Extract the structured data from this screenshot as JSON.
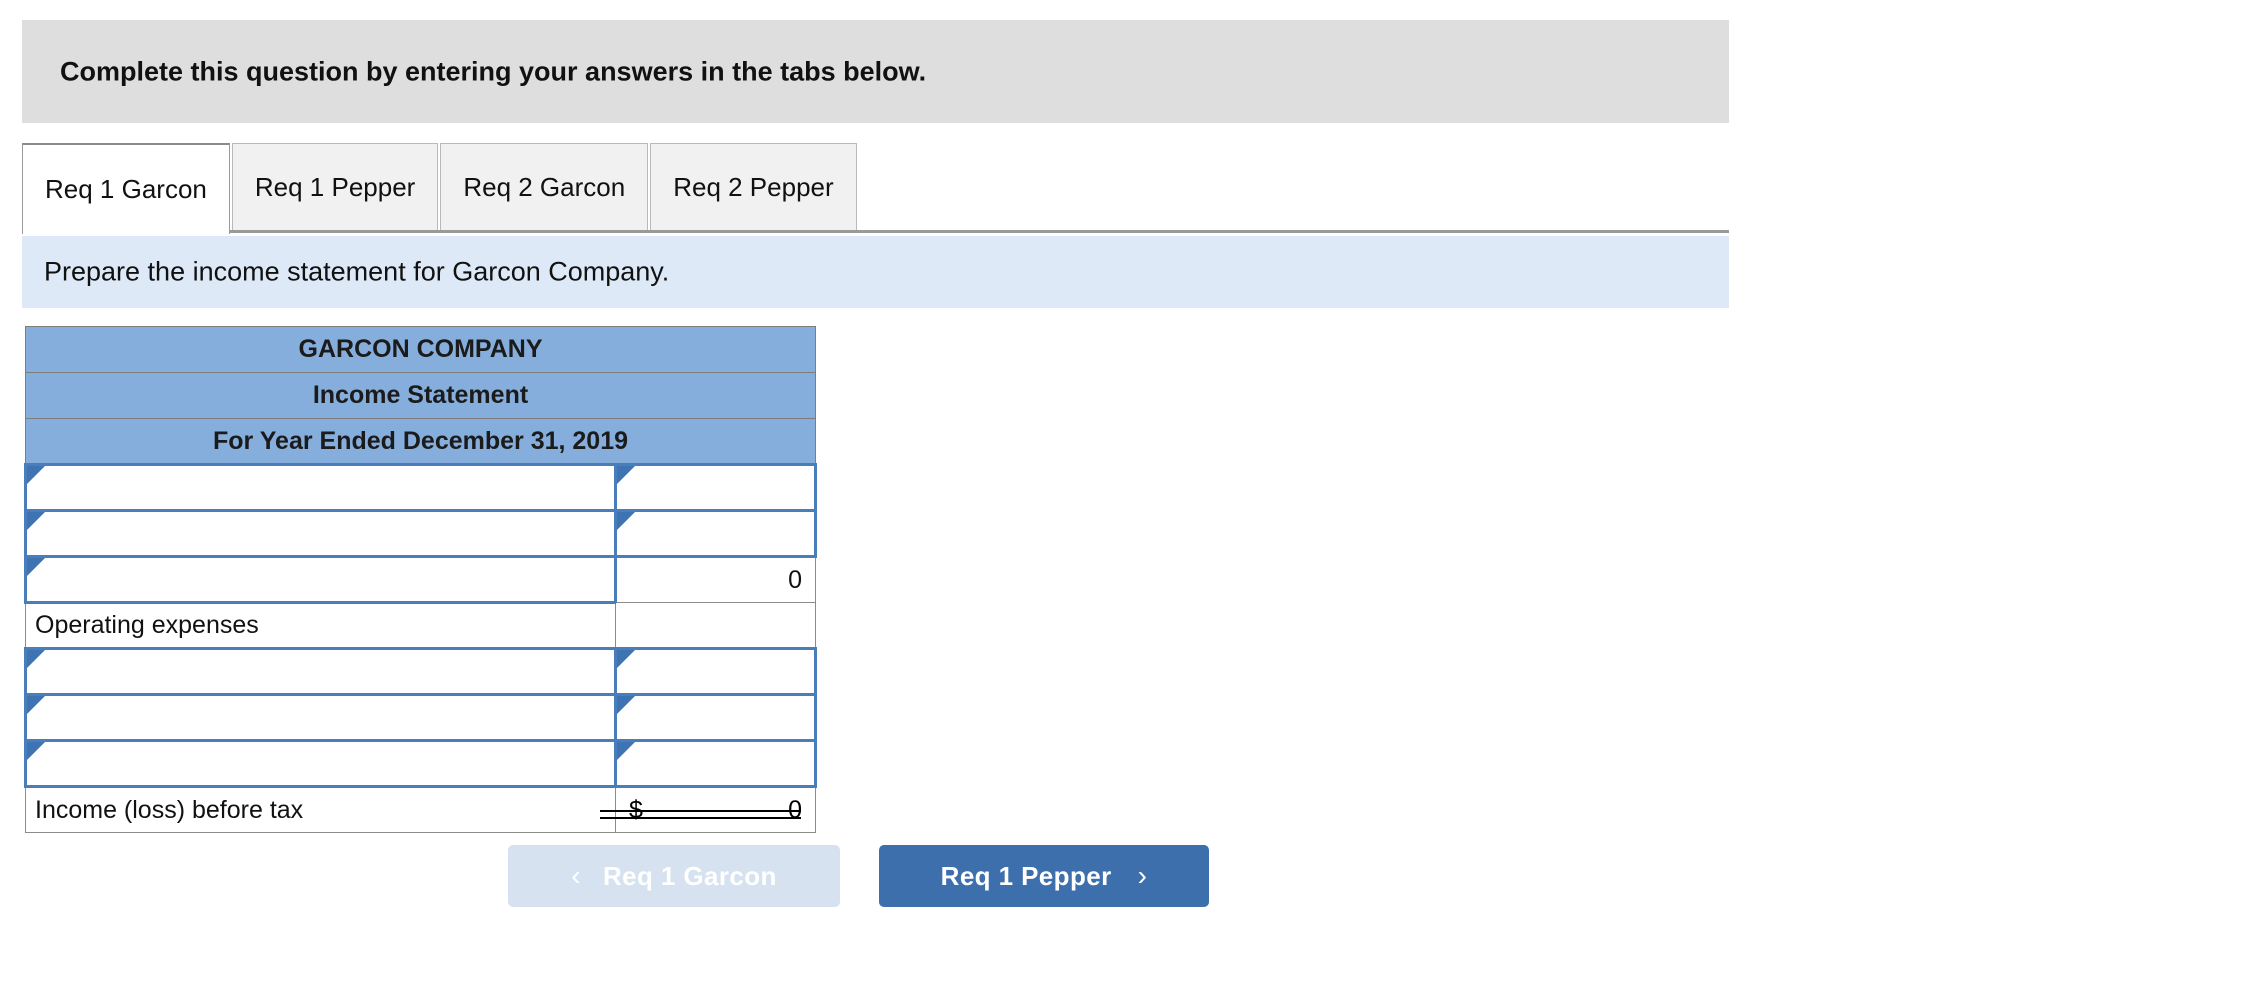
{
  "instruction": {
    "text": "Complete this question by entering your answers in the tabs below."
  },
  "tabs": [
    {
      "label": "Req 1 Garcon",
      "active": true
    },
    {
      "label": "Req 1 Pepper",
      "active": false
    },
    {
      "label": "Req 2 Garcon",
      "active": false
    },
    {
      "label": "Req 2 Pepper",
      "active": false
    }
  ],
  "requirement": {
    "text": "Prepare the income statement for Garcon Company."
  },
  "statement": {
    "title_line_1": "GARCON COMPANY",
    "title_line_2": "Income Statement",
    "title_line_3": "For Year Ended December 31, 2019",
    "rows": [
      {
        "label": "",
        "label_type": "select",
        "value": "",
        "value_type": "select"
      },
      {
        "label": "",
        "label_type": "select",
        "value": "",
        "value_type": "select"
      },
      {
        "label": "",
        "label_type": "select",
        "value": "0",
        "value_type": "subtotal"
      },
      {
        "label": "Operating expenses",
        "label_type": "static",
        "value": "",
        "value_type": "blank"
      },
      {
        "label": "",
        "label_type": "select",
        "value": "",
        "value_type": "select"
      },
      {
        "label": "",
        "label_type": "select",
        "value": "",
        "value_type": "select"
      },
      {
        "label": "",
        "label_type": "select",
        "value": "",
        "value_type": "select"
      },
      {
        "label": "Income (loss) before tax",
        "label_type": "static",
        "value": "0",
        "value_type": "total",
        "currency": "$"
      }
    ]
  },
  "nav": {
    "prev_label": "Req 1 Garcon",
    "prev_chevron": "‹",
    "prev_enabled": false,
    "next_label": "Req 1 Pepper",
    "next_chevron": "›",
    "next_enabled": true
  },
  "colors": {
    "banner_gray": "#dedede",
    "requirement_blue": "#dde9f7",
    "header_blue": "#85aedd",
    "select_border": "#4a7ebb",
    "btn_primary": "#3e6fad",
    "btn_disabled": "#d6e2ef"
  }
}
